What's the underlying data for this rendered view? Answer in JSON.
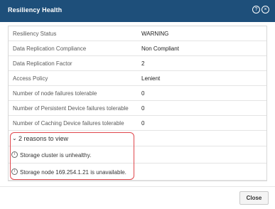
{
  "dialog": {
    "title": "Resiliency Health",
    "help_icon": "question-circle-icon",
    "close_icon": "close-circle-icon",
    "help_glyph": "?",
    "close_glyph": "×"
  },
  "properties": [
    {
      "label": "Resiliency Status",
      "value": "WARNING"
    },
    {
      "label": "Data Replication Compliance",
      "value": "Non Compliant"
    },
    {
      "label": "Data Replication Factor",
      "value": "2"
    },
    {
      "label": "Access Policy",
      "value": "Lenient"
    },
    {
      "label": "Number of node failures tolerable",
      "value": "0"
    },
    {
      "label": "Number of Persistent Device failures tolerable",
      "value": "0"
    },
    {
      "label": "Number of Caching Device failures tolerable",
      "value": "0"
    }
  ],
  "reasons": {
    "header": "2 reasons to view",
    "chevron_glyph": "⌄",
    "info_glyph": "i",
    "items": [
      {
        "text": "Storage cluster is unhealthy."
      },
      {
        "text": "Storage node 169.254.1.21 is unavailable."
      }
    ]
  },
  "footer": {
    "close_label": "Close"
  },
  "colors": {
    "titlebar": "#1e4f7a",
    "highlight": "#e0474c"
  }
}
